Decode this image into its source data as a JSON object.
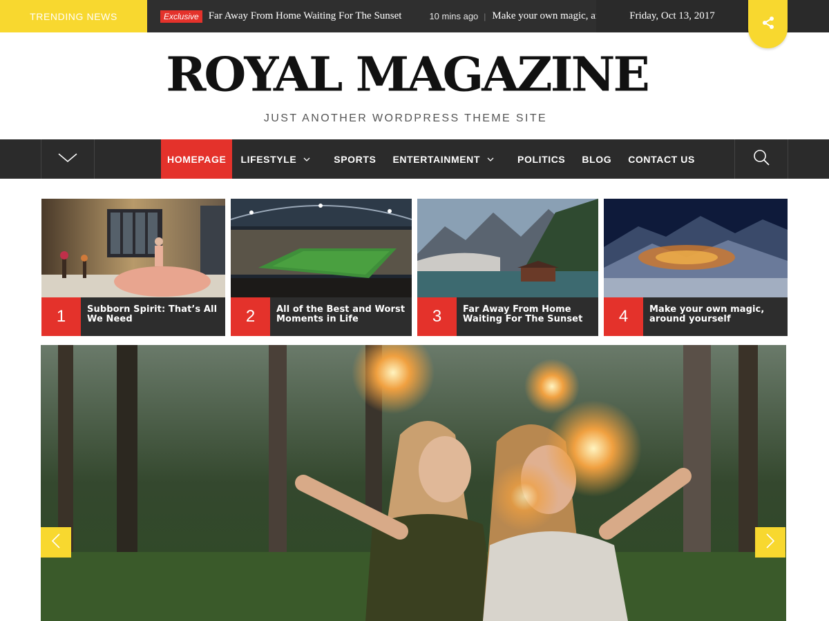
{
  "topbar": {
    "trending_label": "TRENDING NEWS",
    "ticker": [
      {
        "badge": "Exclusive",
        "title": "Far Away From Home Waiting For The Sunset"
      },
      {
        "time": "10 mins ago",
        "title": "Make your own magic, around yourself"
      }
    ],
    "date": "Friday, Oct 13, 2017"
  },
  "header": {
    "site_title": "ROYAL MAGAZINE",
    "tagline": "JUST ANOTHER WORDPRESS THEME SITE"
  },
  "nav": {
    "items": [
      {
        "label": "HOMEPAGE",
        "active": true
      },
      {
        "label": "LIFESTYLE",
        "has_dropdown": true
      },
      {
        "label": "SPORTS"
      },
      {
        "label": "ENTERTAINMENT",
        "has_dropdown": true
      },
      {
        "label": "POLITICS"
      },
      {
        "label": "BLOG"
      },
      {
        "label": "CONTACT US"
      }
    ]
  },
  "featured": [
    {
      "num": "1",
      "title": "Subborn Spirit: That’s All We Need"
    },
    {
      "num": "2",
      "title": "All of the Best and Worst Moments in Life"
    },
    {
      "num": "3",
      "title": "Far Away From Home Waiting For The Sunset"
    },
    {
      "num": "4",
      "title": "Make your own magic, around yourself"
    }
  ],
  "colors": {
    "accent_yellow": "#f8d82f",
    "accent_red": "#e4322b",
    "dark": "#2b2b2b"
  },
  "icons": {
    "share": "share-icon",
    "menu_toggle": "chevron-down-icon",
    "search": "search-icon",
    "prev": "chevron-left-icon",
    "next": "chevron-right-icon"
  }
}
